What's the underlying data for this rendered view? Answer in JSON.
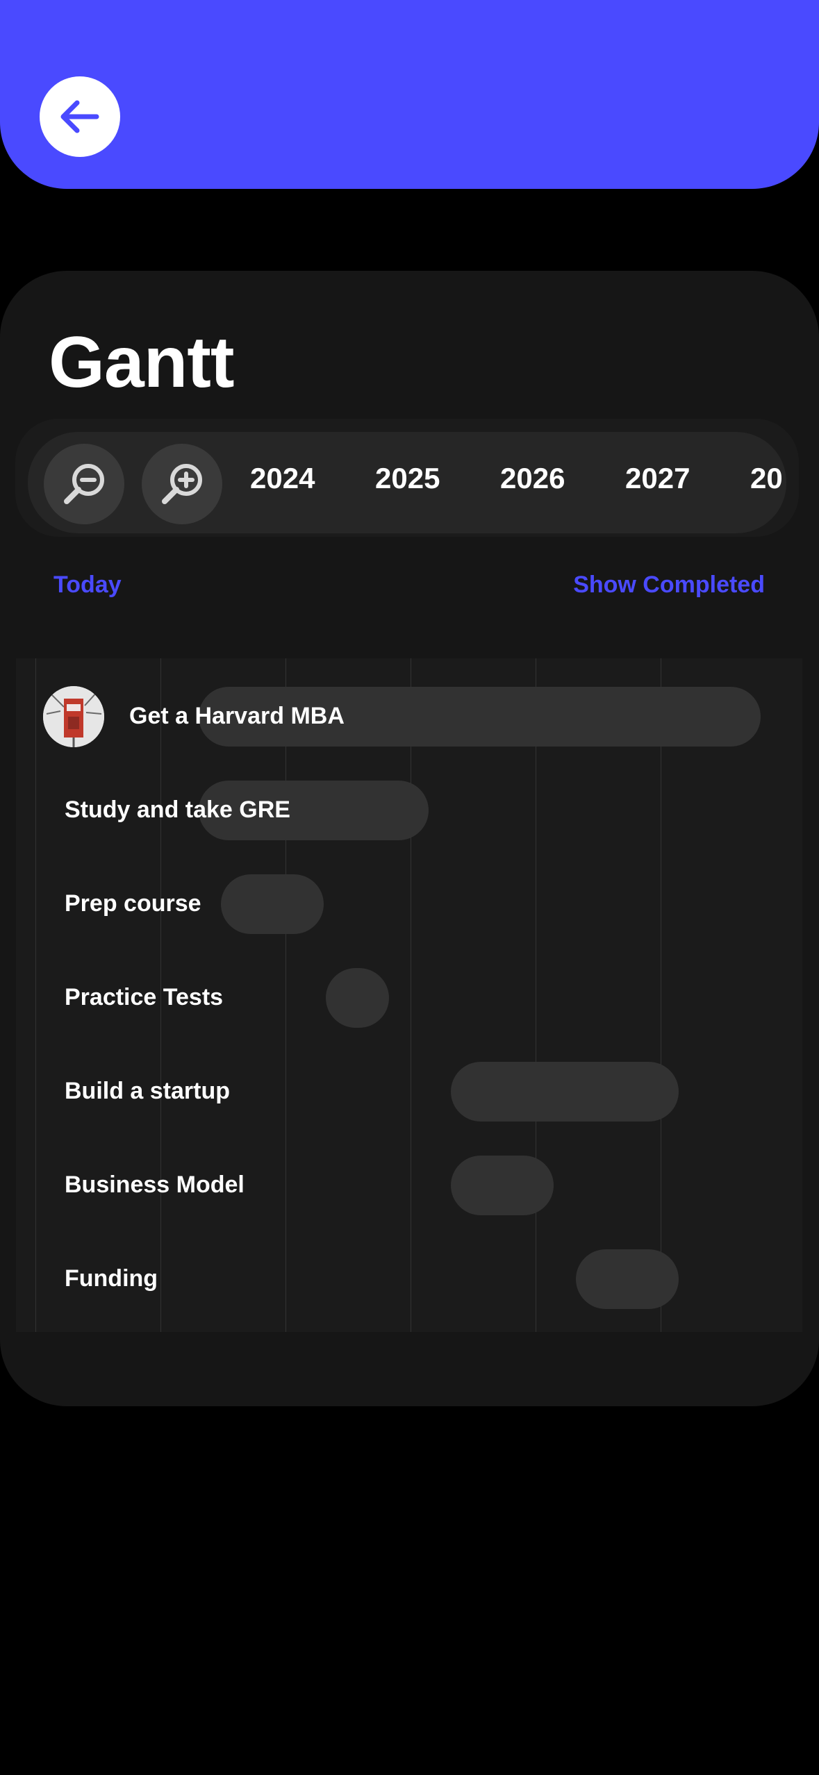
{
  "colors": {
    "accent": "#4a4aff",
    "background": "#000000",
    "card": "#161616",
    "bar": "#323232"
  },
  "header": {
    "back_icon": "arrow-left-icon"
  },
  "gantt": {
    "title": "Gantt",
    "zoom_out_icon": "zoom-out-icon",
    "zoom_in_icon": "zoom-in-icon",
    "years": [
      "2024",
      "2025",
      "2026",
      "2027",
      "20"
    ],
    "today_label": "Today",
    "show_completed_label": "Show Completed",
    "tasks": [
      {
        "label": "Get a Harvard MBA",
        "has_image": true
      },
      {
        "label": "Study and take GRE"
      },
      {
        "label": "Prep course"
      },
      {
        "label": "Practice Tests"
      },
      {
        "label": "Build a startup"
      },
      {
        "label": "Business Model"
      },
      {
        "label": "Funding"
      }
    ]
  }
}
